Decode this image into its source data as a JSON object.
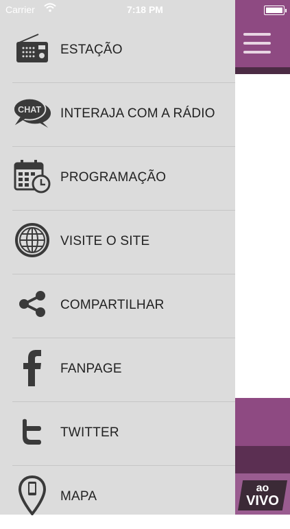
{
  "status_bar": {
    "carrier": "Carrier",
    "time": "7:18 PM"
  },
  "menu": {
    "items": [
      {
        "label": "ESTAÇÃO",
        "icon": "radio-icon"
      },
      {
        "label": "INTERAJA COM A RÁDIO",
        "icon": "chat-icon",
        "icon_text": "CHAT"
      },
      {
        "label": "PROGRAMAÇÃO",
        "icon": "calendar-clock-icon"
      },
      {
        "label": "VISITE O SITE",
        "icon": "globe-icon"
      },
      {
        "label": "COMPARTILHAR",
        "icon": "share-icon"
      },
      {
        "label": "FANPAGE",
        "icon": "facebook-icon"
      },
      {
        "label": "TWITTER",
        "icon": "twitter-icon"
      },
      {
        "label": "MAPA",
        "icon": "map-pin-phone-icon"
      }
    ]
  },
  "live_badge": {
    "line1": "ao",
    "line2": "VIVO"
  },
  "colors": {
    "drawer_bg": "#dcdcdc",
    "brand_purple": "#8e4a82",
    "dark_purple": "#4b2b44",
    "icon_gray": "#3a3a3a"
  }
}
